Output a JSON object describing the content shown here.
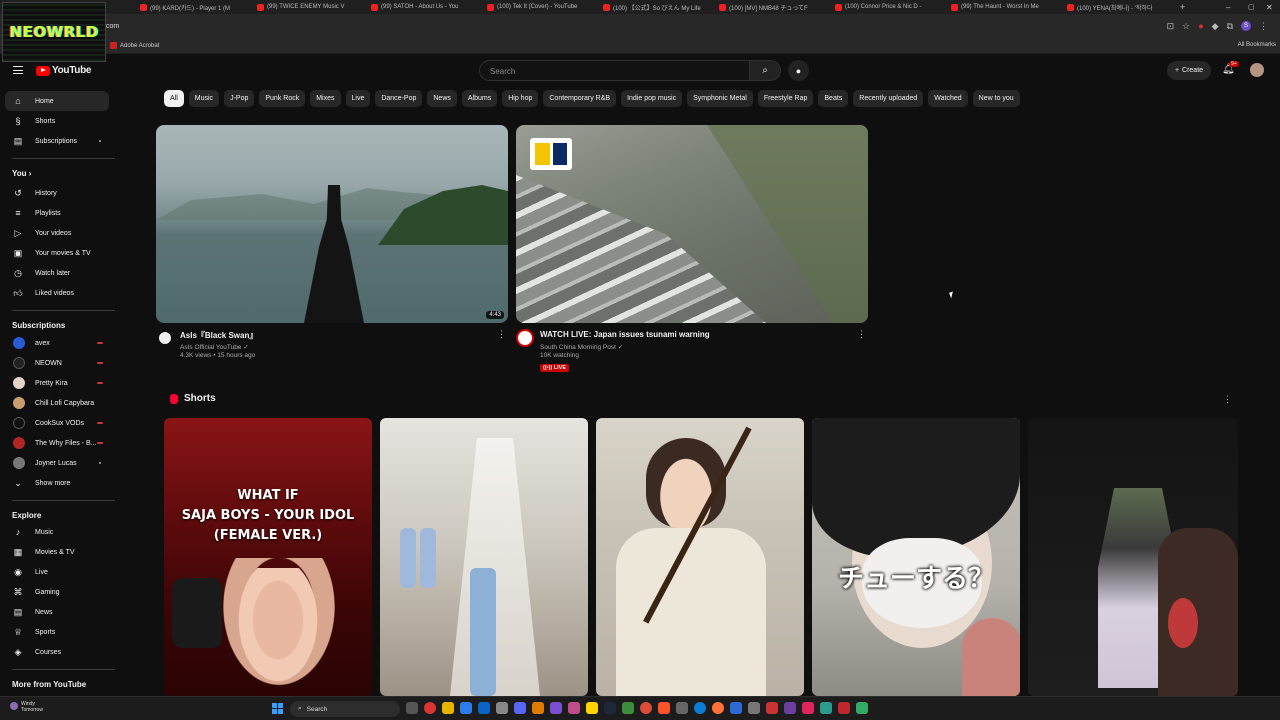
{
  "browser": {
    "tabs": [
      {
        "label": "(99) KARD(카드) - Player 1 (M"
      },
      {
        "label": "(99) TWICE ENEMY Music V"
      },
      {
        "label": "(99) SATOH - About Us - You"
      },
      {
        "label": "(100) Tek It (Cover) - YouTube"
      },
      {
        "label": "(100) 【公式】So びえん My Life"
      },
      {
        "label": "(100) [MV] NMB48 チュってF"
      },
      {
        "label": "(100) Connor Price & Nic D - "
      },
      {
        "label": "(99) The Haunt - Worst In Me"
      },
      {
        "label": "(100) YENA(최예나) - '착하다"
      }
    ],
    "url": "com",
    "bookmark": "Adobe Acrobat",
    "all_bookmarks": "All Bookmarks",
    "profile_letter": "S"
  },
  "overlay_logo": "NEOWRLD",
  "header": {
    "logo_text": "YouTube",
    "search_placeholder": "Search",
    "create_label": "Create",
    "notif_count": "9+"
  },
  "chips": [
    "All",
    "Music",
    "J-Pop",
    "Punk Rock",
    "Mixes",
    "Live",
    "Dance-Pop",
    "News",
    "Albums",
    "Hip hop",
    "Contemporary R&B",
    "Indie pop music",
    "Symphonic Metal",
    "Freestyle Rap",
    "Beats",
    "Recently uploaded",
    "Watched",
    "New to you"
  ],
  "sidebar": {
    "main": [
      {
        "label": "Home",
        "icon": "home-icon"
      },
      {
        "label": "Shorts",
        "icon": "shorts-icon"
      },
      {
        "label": "Subscriptions",
        "icon": "subscriptions-icon"
      }
    ],
    "you_header": "You",
    "you_items": [
      {
        "label": "History",
        "icon": "history-icon"
      },
      {
        "label": "Playlists",
        "icon": "playlists-icon"
      },
      {
        "label": "Your videos",
        "icon": "your-videos-icon"
      },
      {
        "label": "Your movies & TV",
        "icon": "movies-tv-icon"
      },
      {
        "label": "Watch later",
        "icon": "watch-later-icon"
      },
      {
        "label": "Liked videos",
        "icon": "liked-icon"
      }
    ],
    "subscriptions_header": "Subscriptions",
    "subscriptions": [
      {
        "label": "avex",
        "color": "#2a5bd7"
      },
      {
        "label": "NEOWN",
        "color": "#222222"
      },
      {
        "label": "Pretty Kira",
        "color": "#e6d1c8"
      },
      {
        "label": "Chill Lofi Capybara",
        "color": "#c8a070"
      },
      {
        "label": "CookSux VODs",
        "color": "#111111"
      },
      {
        "label": "The Why Files - B...",
        "color": "#b32626"
      },
      {
        "label": "Joyner Lucas",
        "color": "#777777"
      }
    ],
    "show_more": "Show more",
    "explore_header": "Explore",
    "explore": [
      {
        "label": "Music",
        "icon": "music-icon"
      },
      {
        "label": "Movies & TV",
        "icon": "film-icon"
      },
      {
        "label": "Live",
        "icon": "live-icon"
      },
      {
        "label": "Gaming",
        "icon": "gaming-icon"
      },
      {
        "label": "News",
        "icon": "news-icon"
      },
      {
        "label": "Sports",
        "icon": "sports-icon"
      },
      {
        "label": "Courses",
        "icon": "courses-icon"
      }
    ],
    "more_header": "More from YouTube"
  },
  "videos": [
    {
      "title": "AsIs『Black Swan』",
      "channel": "AsIs Official YouTube",
      "stats": "4.3K views • 15 hours ago",
      "duration": "4:43"
    },
    {
      "title": "WATCH LIVE: Japan issues tsunami warning",
      "channel": "South China Morning Post",
      "stats": "10K watching",
      "badge": "LIVE"
    }
  ],
  "shorts": {
    "title": "Shorts",
    "items": [
      {
        "overlay": "WHAT IF\nSAJA BOYS - YOUR IDOL\n(FEMALE VER.)"
      },
      {
        "overlay": ""
      },
      {
        "overlay": ""
      },
      {
        "overlay": "チューする？"
      },
      {
        "overlay": ""
      }
    ]
  },
  "taskbar": {
    "weather_title": "Windy",
    "weather_sub": "Tomorrow",
    "search_label": "Search"
  }
}
